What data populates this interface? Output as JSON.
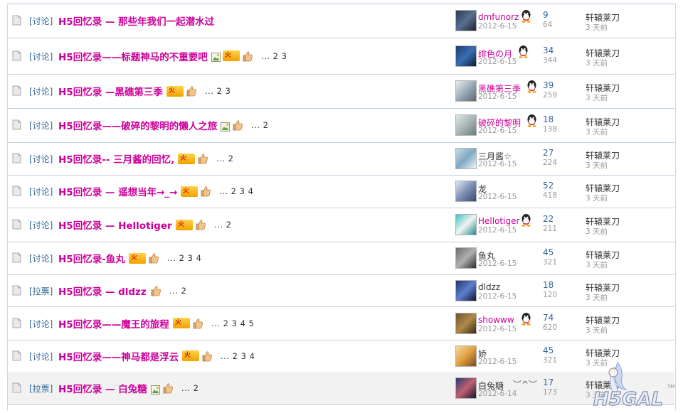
{
  "colors": {
    "title": "#cc0099",
    "tag": "#336699",
    "divider": "#c2d1df",
    "highlight_row": "#f2f2f2"
  },
  "rows": [
    {
      "tag": "[讨论]",
      "title": "H5回忆录 — 那些年我们一起潜水过",
      "extras": [],
      "pages": "",
      "author": "dmfunorz",
      "author_color": "#cc0099",
      "date": "2012-6-15",
      "qq": true,
      "replies": "9",
      "views": "64",
      "last_user": "轩辕莱刀",
      "last_time": "3 天前",
      "avatar_colors": [
        "#2a3a55",
        "#5a7090",
        "#1a2230"
      ]
    },
    {
      "tag": "[讨论]",
      "title": "H5回忆录——标题神马的不重要吧",
      "extras": [
        "image-icon",
        "hot-icon",
        "thumbs-up-icon"
      ],
      "pages": "... 2  3",
      "author": "绯色の月",
      "author_color": "#cc0099",
      "date": "2012-6-15",
      "qq": true,
      "replies": "34",
      "views": "344",
      "last_user": "轩辕莱刀",
      "last_time": "3 天前",
      "avatar_colors": [
        "#1c3d6e",
        "#3b6eb5",
        "#0e1c33"
      ]
    },
    {
      "tag": "[讨论]",
      "title": "H5回忆录 —黑礁第三季",
      "extras": [
        "hot-icon",
        "thumbs-up-icon"
      ],
      "pages": "... 2  3",
      "author": "黑礁第三季",
      "author_color": "#cc0099",
      "date": "2012-6-15",
      "qq": true,
      "replies": "39",
      "views": "259",
      "last_user": "轩辕莱刀",
      "last_time": "3 天前",
      "avatar_colors": [
        "#e8eef2",
        "#9aaab8",
        "#5d6a78"
      ]
    },
    {
      "tag": "[讨论]",
      "title": "H5回忆录——破碎的黎明的懒人之旅",
      "extras": [
        "image-icon",
        "thumbs-up-icon"
      ],
      "pages": "... 2",
      "author": "破碎的黎明",
      "author_color": "#cc0099",
      "date": "2012-6-15",
      "qq": true,
      "replies": "18",
      "views": "138",
      "last_user": "轩辕莱刀",
      "last_time": "3 天前",
      "avatar_colors": [
        "#dfe6e6",
        "#a8b6b6",
        "#6d7a7a"
      ]
    },
    {
      "tag": "[讨论]",
      "title": "H5回忆录-- 三月酱的回忆,",
      "extras": [
        "hot-icon",
        "thumbs-up-icon"
      ],
      "pages": "... 2",
      "author": "三月酱☆",
      "author_color": "#333333",
      "date": "2012-6-15",
      "qq": false,
      "replies": "27",
      "views": "224",
      "last_user": "轩辕莱刀",
      "last_time": "3 天前",
      "avatar_colors": [
        "#c7dbe6",
        "#7fa9c2",
        "#f2f6f8"
      ]
    },
    {
      "tag": "[讨论]",
      "title": "H5回忆录 — 遥想当年→_→",
      "extras": [
        "hot-icon",
        "thumbs-up-icon"
      ],
      "pages": "... 2  3  4",
      "author": "龙",
      "author_color": "#333333",
      "date": "2012-6-15",
      "qq": false,
      "replies": "52",
      "views": "418",
      "last_user": "轩辕莱刀",
      "last_time": "3 天前",
      "avatar_colors": [
        "#e0e6f0",
        "#7c8fb5",
        "#3a4a70"
      ]
    },
    {
      "tag": "[讨论]",
      "title": "H5回忆录 — Hellotiger",
      "extras": [
        "hot-icon",
        "thumbs-up-icon"
      ],
      "pages": "... 2",
      "author": "Hellotiger",
      "author_color": "#cc0099",
      "date": "2012-6-15",
      "qq": true,
      "replies": "22",
      "views": "211",
      "last_user": "轩辕莱刀",
      "last_time": "3 天前",
      "avatar_colors": [
        "#3cc4c0",
        "#f3f3f3",
        "#1f8c8a"
      ]
    },
    {
      "tag": "[讨论]",
      "title": "H5回忆录-鱼丸",
      "extras": [
        "hot-icon",
        "thumbs-up-icon"
      ],
      "pages": "... 2  3  4",
      "author": "鱼丸",
      "author_color": "#333333",
      "date": "2012-6-15",
      "qq": false,
      "replies": "45",
      "views": "321",
      "last_user": "轩辕莱刀",
      "last_time": "3 天前",
      "avatar_colors": [
        "#6a6a6a",
        "#b0b0b0",
        "#2b2b2b"
      ]
    },
    {
      "tag": "[拉票]",
      "title": "H5回忆录 — dldzz",
      "extras": [
        "thumbs-up-icon"
      ],
      "pages": "... 2",
      "author": "dldzz",
      "author_color": "#333333",
      "date": "2012-6-15",
      "qq": false,
      "replies": "18",
      "views": "120",
      "last_user": "轩辕莱刀",
      "last_time": "3 天前",
      "avatar_colors": [
        "#24346a",
        "#5f7ed0",
        "#0c1430"
      ]
    },
    {
      "tag": "[讨论]",
      "title": "H5回忆录——魔王的旅程",
      "extras": [
        "hot-icon",
        "thumbs-up-icon"
      ],
      "pages": "... 2  3  4  5",
      "author": "showww",
      "author_color": "#cc0099",
      "date": "2012-6-15",
      "qq": true,
      "replies": "74",
      "views": "620",
      "last_user": "轩辕莱刀",
      "last_time": "3 天前",
      "avatar_colors": [
        "#6b5230",
        "#b08a4a",
        "#3a2a15"
      ]
    },
    {
      "tag": "[讨论]",
      "title": "H5回忆录——神马都是浮云",
      "extras": [
        "hot-icon",
        "thumbs-up-icon"
      ],
      "pages": "... 2  3  4",
      "author": "娇",
      "author_color": "#333333",
      "date": "2012-6-15",
      "qq": false,
      "replies": "45",
      "views": "321",
      "last_user": "轩辕莱刀",
      "last_time": "3 天前",
      "avatar_colors": [
        "#f4d9a0",
        "#e0a040",
        "#7a4a20"
      ]
    },
    {
      "tag": "[拉票]",
      "title": "H5回忆录 — 白兔糖",
      "extras": [
        "image-icon",
        "thumbs-up-icon"
      ],
      "pages": "... 2",
      "author": "白兔糖",
      "author_color": "#333333",
      "date": "2012-6-14",
      "qq": false,
      "replies": "17",
      "views": "173",
      "last_user": "轩辕莱刀",
      "last_time": "3 天前",
      "avatar_colors": [
        "#2a3d70",
        "#c06070",
        "#10182e"
      ],
      "emoticon": "︶^︶"
    }
  ],
  "watermark": {
    "text": "H5GAL",
    "suffix": "TM"
  }
}
